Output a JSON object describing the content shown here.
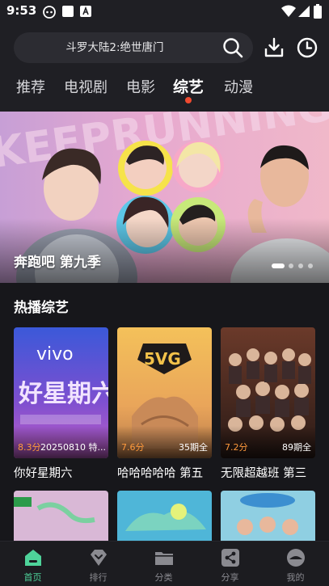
{
  "status_bar": {
    "time": "9:53"
  },
  "search": {
    "text": "斗罗大陆2:绝世唐门"
  },
  "tabs": [
    {
      "label": "推荐"
    },
    {
      "label": "电视剧"
    },
    {
      "label": "电影"
    },
    {
      "label": "综艺",
      "active": true
    },
    {
      "label": "动漫"
    }
  ],
  "banner": {
    "title": "奔跑吧 第九季",
    "slide_count": 4,
    "current_slide": 1
  },
  "section": {
    "title": "热播综艺"
  },
  "cards": [
    {
      "title": "你好星期六",
      "score": "8.3分",
      "episodes": "20250810 特..."
    },
    {
      "title": "哈哈哈哈哈 第五",
      "score": "7.6分",
      "episodes": "35期全"
    },
    {
      "title": "无限超越班 第三",
      "score": "7.2分",
      "episodes": "89期全"
    }
  ],
  "bottom_nav": [
    {
      "label": "首页",
      "icon": "home-icon",
      "active": true
    },
    {
      "label": "排行",
      "icon": "rank-icon"
    },
    {
      "label": "分类",
      "icon": "folder-icon"
    },
    {
      "label": "分享",
      "icon": "share-icon"
    },
    {
      "label": "我的",
      "icon": "profile-icon"
    }
  ],
  "colors": {
    "background": "#17171b",
    "accent_green": "#4ed39a",
    "tab_dot": "#f04a30",
    "score_orange": "#ff9a3c"
  }
}
